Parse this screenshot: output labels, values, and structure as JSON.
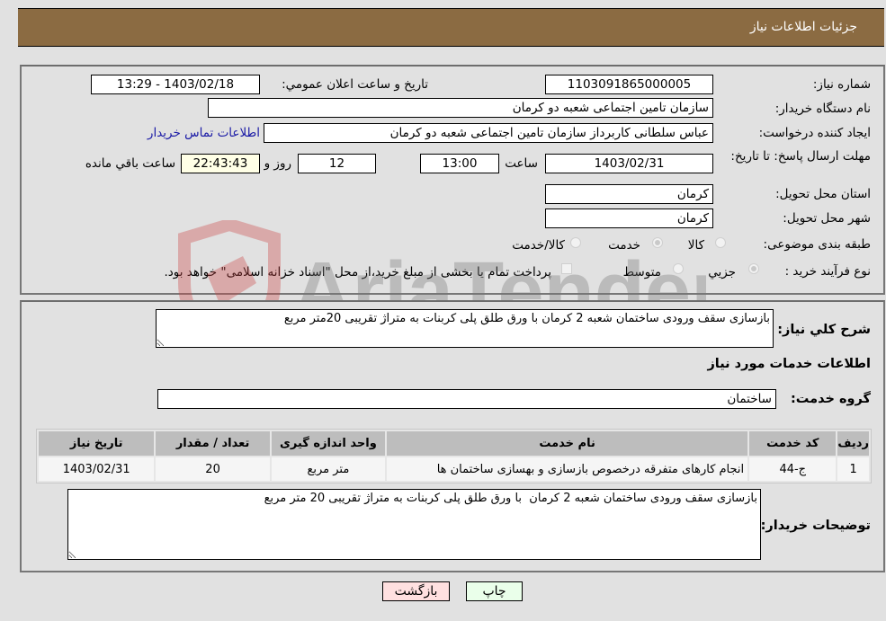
{
  "header": {
    "title": "جزئیات اطلاعات نیاز"
  },
  "details": {
    "need_number_label": "شماره نیاز:",
    "need_number": "1103091865000005",
    "announce_label": "تاریخ و ساعت اعلان عمومي:",
    "announce_value": "1403/02/18 - 13:29",
    "buyer_org_label": "نام دستگاه خریدار:",
    "buyer_org": "سازمان تامین اجتماعی شعبه دو کرمان",
    "creator_label": "ایجاد کننده درخواست:",
    "creator": "عباس سلطانی کاربرداز سازمان تامین اجتماعی شعبه دو کرمان",
    "contact_link": "اطلاعات تماس خریدار",
    "deadline_label": "مهلت ارسال پاسخ: تا تاریخ:",
    "deadline_date": "1403/02/31",
    "time_label": "ساعت",
    "deadline_time": "13:00",
    "days_value": "12",
    "days_label": "روز و",
    "remaining_time": "22:43:43",
    "remaining_label": "ساعت باقي مانده",
    "province_label": "استان محل تحویل:",
    "province": "کرمان",
    "city_label": "شهر محل تحویل:",
    "city": "کرمان",
    "category_label": "طبقه بندی موضوعی:",
    "category_options": [
      {
        "label": "کالا",
        "selected": false
      },
      {
        "label": "خدمت",
        "selected": true
      },
      {
        "label": "کالا/خدمت",
        "selected": false
      }
    ],
    "process_label": "نوع فرآیند خرید :",
    "process_options": [
      {
        "label": "جزيي",
        "selected": true
      },
      {
        "label": "متوسط",
        "selected": false
      }
    ],
    "treasury_checkbox_label": "پرداخت تمام یا بخشی از مبلغ خرید،از محل \"اسناد خزانه اسلامی\" خواهد بود.",
    "treasury_checked": false
  },
  "summary": {
    "label": "شرح کلي نیاز:",
    "value": "بازسازی سقف ورودی ساختمان شعبه 2 کرمان با ورق طلق پلی کربنات به متراژ تقریبی 20متر مربع"
  },
  "services": {
    "section_title": "اطلاعات خدمات مورد نیاز",
    "group_label": "گروه خدمت:",
    "group_value": "ساختمان",
    "table": {
      "headers": [
        "ردیف",
        "کد خدمت",
        "نام خدمت",
        "واحد اندازه گیری",
        "تعداد / مقدار",
        "تاریخ نیاز"
      ],
      "rows": [
        [
          "1",
          "ج-44",
          "انجام کارهای متفرقه درخصوص بازسازی و بهسازی ساختمان ها",
          "متر مربع",
          "20",
          "1403/02/31"
        ]
      ]
    },
    "buyer_notes_label": "توضیحات خریدار:",
    "buyer_notes": "بازسازی سقف ورودی ساختمان شعبه 2 کرمان  با ورق طلق پلی کربنات به متراژ تقریبی 20 متر مربع"
  },
  "buttons": {
    "print": "چاپ",
    "back": "بازگشت"
  },
  "watermark": {
    "text": "AriaTender.neT"
  },
  "colors": {
    "header_bg": "#8b6b42",
    "back_bg": "#ffe0e0",
    "print_bg": "#eaffea",
    "remaining_bg": "#ffffe6",
    "link": "#1a1aa6"
  }
}
